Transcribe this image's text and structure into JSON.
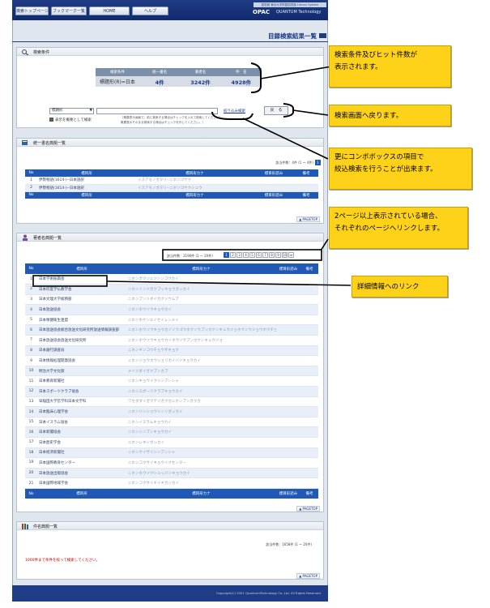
{
  "nav": {
    "tabs": [
      "検索トップページ",
      "ブックマーク一覧",
      "HOME",
      "ヘルプ"
    ]
  },
  "logo": {
    "sub": "図書館 東京大学附属図書館 Library System",
    "opac": "OPAC",
    "brand": "QUANTUM Technology"
  },
  "page_title": "目録検索結果一覧",
  "conditions": {
    "heading": "検索条件",
    "headers": [
      "検索条件",
      "統一書名",
      "著者名",
      "件　名"
    ],
    "values": [
      "標題形(R)=日本",
      "4件",
      "3242件",
      "4928件"
    ]
  },
  "filter": {
    "select": "標題形",
    "button": "絞り込み検索",
    "back": "戻　る",
    "checkbox_label": "表示を概要として検索",
    "note1": "［概要表示画面で、前に検索する場合はチェックを入れて検索してください］",
    "note2": "概要表示そのまま検索する場合はチェックを外してください。］"
  },
  "uniform": {
    "heading": "統一書名典拠一覧",
    "count": "該当件数：4件 (1 ～ 4件)",
    "page": "1",
    "headers": [
      "No",
      "標目形",
      "標目形カナ",
      "標目形読み",
      "備考"
    ],
    "rows": [
      {
        "no": "1",
        "title": "伊勢物語(1614-)--日本語訳",
        "kana": "イスアモノガタリ--ニホンゴヤク",
        "yomi": "",
        "note": ""
      },
      {
        "no": "2",
        "title": "伊勢物語(1614-)--日本語訳",
        "kana": "イスアモノガタリ--ニホンゴヤクシュウ",
        "yomi": "",
        "note": ""
      }
    ],
    "pagetop": "▲ PAGETOP"
  },
  "authors": {
    "heading": "著者名典拠一覧",
    "count": "該当件数：3196件 (1 ～ 20件)",
    "pages": [
      "1",
      "2",
      "3",
      "4",
      "5",
      "6",
      "7",
      "8",
      "9",
      "10",
      "≫"
    ],
    "headers": [
      "No",
      "標目形",
      "標目形カナ",
      "標目形読み",
      "備考"
    ],
    "rows": [
      {
        "no": "1",
        "title": "日本学術振興会",
        "kana": "ニホンガクジュツシンコウカイ"
      },
      {
        "no": "2",
        "title": "日本印度学仏教学会",
        "kana": "ニホンインドガクブッキョウガッカイ"
      },
      {
        "no": "3",
        "title": "日本文理大学総務部",
        "kana": "ニホンブンリダイガクソウムブ"
      },
      {
        "no": "4",
        "title": "日本放送協会",
        "kana": "ニホンホウソウキョウカイ"
      },
      {
        "no": "5",
        "title": "日本保健衛生連盟",
        "kana": "ニホンホケンエイセイレンメイ"
      },
      {
        "no": "6",
        "title": "日本放送協会総合放送文化研究所放送情報調査部",
        "kana": "ニホンホウソウキョウカイソウゴウホウソウブンカケンキュウジョホウソウジョウホウチョウサブ"
      },
      {
        "no": "7",
        "title": "日本放送協会放送文化研究所",
        "kana": "ニホンホウソウキョウカイホウソウブンカケンキュウジョ"
      },
      {
        "no": "8",
        "title": "日本銀行調査局",
        "kana": "ニホンギンコウチョウサキョク"
      },
      {
        "no": "9",
        "title": "日本情報処理開発協会",
        "kana": "ニホンジョウホウショリカイハツキョウカイ"
      },
      {
        "no": "10",
        "title": "明治大学文化部",
        "kana": "メイジダイガクブンカブ"
      },
      {
        "no": "11",
        "title": "日本教育新聞社",
        "kana": "ニホンキョウイクシンブンシャ"
      },
      {
        "no": "12",
        "title": "日本スポーツクラブ協会",
        "kana": "ニホンスポーツクラブキョウカイ"
      },
      {
        "no": "13",
        "title": "早稲田大学哲学科日本文学科",
        "kana": "ワセダダイガクテツガクカニホンブンガクカ"
      },
      {
        "no": "14",
        "title": "日本臨床心理学会",
        "kana": "ニホンリンショウシンリガッカイ"
      },
      {
        "no": "15",
        "title": "日本イスラム協会",
        "kana": "ニホンイスラムキョウカイ"
      },
      {
        "no": "16",
        "title": "日本新聞協会",
        "kana": "ニホンシンブンキョウカイ"
      },
      {
        "no": "17",
        "title": "日本歴史学会",
        "kana": "ニホンレキシガッカイ"
      },
      {
        "no": "18",
        "title": "日本経済新聞社",
        "kana": "ニホンケイザイシンブンシャ"
      },
      {
        "no": "19",
        "title": "日本国際教育センター",
        "kana": "ニホンコクサイキョウイクセンター"
      },
      {
        "no": "20",
        "title": "日本放送出版協会",
        "kana": "ニホンホウソウシュッパンキョウカイ"
      },
      {
        "no": "21",
        "title": "日本国際地域学会",
        "kana": "ニホンコクサイチイキガッカイ"
      }
    ],
    "pagetop": "▲ PAGETOP"
  },
  "subjects": {
    "heading": "件名典拠一覧",
    "count": "該当件数：1658件 (1 ～ 20件)",
    "warning": "1000件まで条件を絞って検索してください。",
    "pagetop": "▲ PAGETOP"
  },
  "footer": {
    "copyright": "Copyright(C) 2001 QuantumTechnology Co.,Ltd. All Rights Reserved."
  },
  "callouts": {
    "c1": "検索条件及びヒット件数が",
    "c1b": "表示されます。",
    "c2": "検索画面へ戻ります。",
    "c3": "更にコンボボックスの項目で",
    "c3b": "絞込検索を行うことが出来ます。",
    "c4": "2ページ以上表示されている場合、",
    "c4b": "それぞれのページへリンクします。",
    "c5": "詳細情報へのリンク"
  }
}
